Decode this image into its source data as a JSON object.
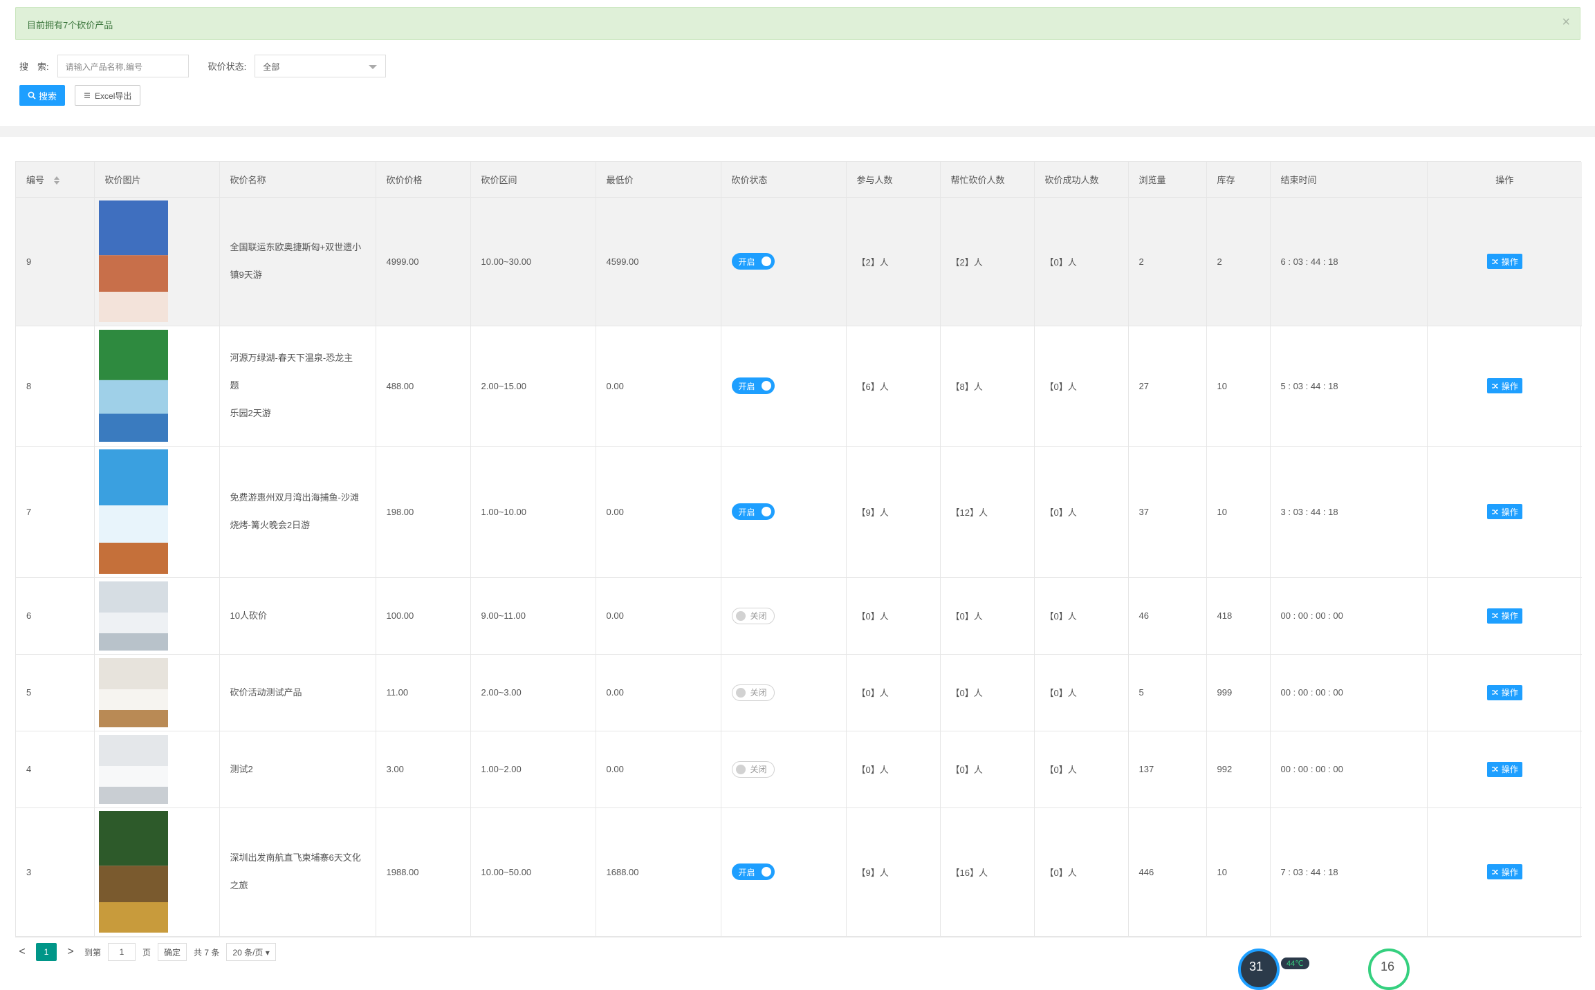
{
  "alert": {
    "text": "目前拥有7个砍价产品",
    "close": "×"
  },
  "filters": {
    "search_label": "搜　索:",
    "search_placeholder": "请输入产品名称,编号",
    "status_label": "砍价状态:",
    "status_value": "全部"
  },
  "buttons": {
    "search": "搜索",
    "export": "Excel导出"
  },
  "table": {
    "headers": [
      "编号",
      "砍价图片",
      "砍价名称",
      "砍价价格",
      "砍价区间",
      "最低价",
      "砍价状态",
      "参与人数",
      "帮忙砍价人数",
      "砍价成功人数",
      "浏览量",
      "库存",
      "结束时间",
      "操作"
    ],
    "rows": [
      {
        "id": "9",
        "name_line1": "全国联运东欧奥捷斯匈+双世遗小",
        "name_line2": "镇9天游",
        "price": "4999.00",
        "range": "10.00~30.00",
        "min": "4599.00",
        "status": "开启",
        "on": true,
        "join": "【2】人",
        "help": "【2】人",
        "success": "【0】人",
        "views": "2",
        "stock": "2",
        "end": "6 : 03 : 44 : 18",
        "op": "操作",
        "img_colors": [
          "#3f6fbf",
          "#c86f4a",
          "#f3e3da"
        ]
      },
      {
        "id": "8",
        "name_line1": "河源万绿湖-春天下温泉-恐龙主题",
        "name_line2": "乐园2天游",
        "price": "488.00",
        "range": "2.00~15.00",
        "min": "0.00",
        "status": "开启",
        "on": true,
        "join": "【6】人",
        "help": "【8】人",
        "success": "【0】人",
        "views": "27",
        "stock": "10",
        "end": "5 : 03 : 44 : 18",
        "op": "操作",
        "img_colors": [
          "#2e8a3f",
          "#9fd0e8",
          "#3a7bbf"
        ]
      },
      {
        "id": "7",
        "name_line1": "免费游惠州双月湾出海捕鱼-沙滩",
        "name_line2": "烧烤-篝火晚会2日游",
        "price": "198.00",
        "range": "1.00~10.00",
        "min": "0.00",
        "status": "开启",
        "on": true,
        "join": "【9】人",
        "help": "【12】人",
        "success": "【0】人",
        "views": "37",
        "stock": "10",
        "end": "3 : 03 : 44 : 18",
        "op": "操作",
        "img_colors": [
          "#3aa0e0",
          "#e8f4fb",
          "#c5703a"
        ]
      },
      {
        "id": "6",
        "name_line1": "10人砍价",
        "name_line2": "",
        "price": "100.00",
        "range": "9.00~11.00",
        "min": "0.00",
        "status": "关闭",
        "on": false,
        "join": "【0】人",
        "help": "【0】人",
        "success": "【0】人",
        "views": "46",
        "stock": "418",
        "end": "00 : 00 : 00 : 00",
        "op": "操作",
        "img_colors": [
          "#d6dde3",
          "#eef1f4",
          "#b8c2ca"
        ]
      },
      {
        "id": "5",
        "name_line1": "砍价活动测试产品",
        "name_line2": "",
        "price": "11.00",
        "range": "2.00~3.00",
        "min": "0.00",
        "status": "关闭",
        "on": false,
        "join": "【0】人",
        "help": "【0】人",
        "success": "【0】人",
        "views": "5",
        "stock": "999",
        "end": "00 : 00 : 00 : 00",
        "op": "操作",
        "img_colors": [
          "#e7e3dc",
          "#f6f4f0",
          "#b98a55"
        ]
      },
      {
        "id": "4",
        "name_line1": "测试2",
        "name_line2": "",
        "price": "3.00",
        "range": "1.00~2.00",
        "min": "0.00",
        "status": "关闭",
        "on": false,
        "join": "【0】人",
        "help": "【0】人",
        "success": "【0】人",
        "views": "137",
        "stock": "992",
        "end": "00 : 00 : 00 : 00",
        "op": "操作",
        "img_colors": [
          "#e4e7ea",
          "#f7f8f9",
          "#c9ced3"
        ]
      },
      {
        "id": "3",
        "name_line1": "深圳出发南航直飞柬埔寨6天文化",
        "name_line2": "之旅",
        "price": "1988.00",
        "range": "10.00~50.00",
        "min": "1688.00",
        "status": "开启",
        "on": true,
        "join": "【9】人",
        "help": "【16】人",
        "success": "【0】人",
        "views": "446",
        "stock": "10",
        "end": "7 : 03 : 44 : 18",
        "op": "操作",
        "img_colors": [
          "#2d5a2a",
          "#7a5a2e",
          "#c89b3c"
        ]
      }
    ]
  },
  "pager": {
    "prev": "<",
    "current": "1",
    "next": ">",
    "goto_label": "到第",
    "goto_value": "1",
    "page_unit": "页",
    "confirm": "确定",
    "total": "共 7 条",
    "per_page": "20 条/页 ▾"
  },
  "widgets": {
    "cpu": "31",
    "temp": "44℃",
    "mem": "16"
  },
  "colors": {
    "primary": "#1e9fff",
    "alert_bg": "#dff0d8",
    "pager_active": "#009688"
  }
}
